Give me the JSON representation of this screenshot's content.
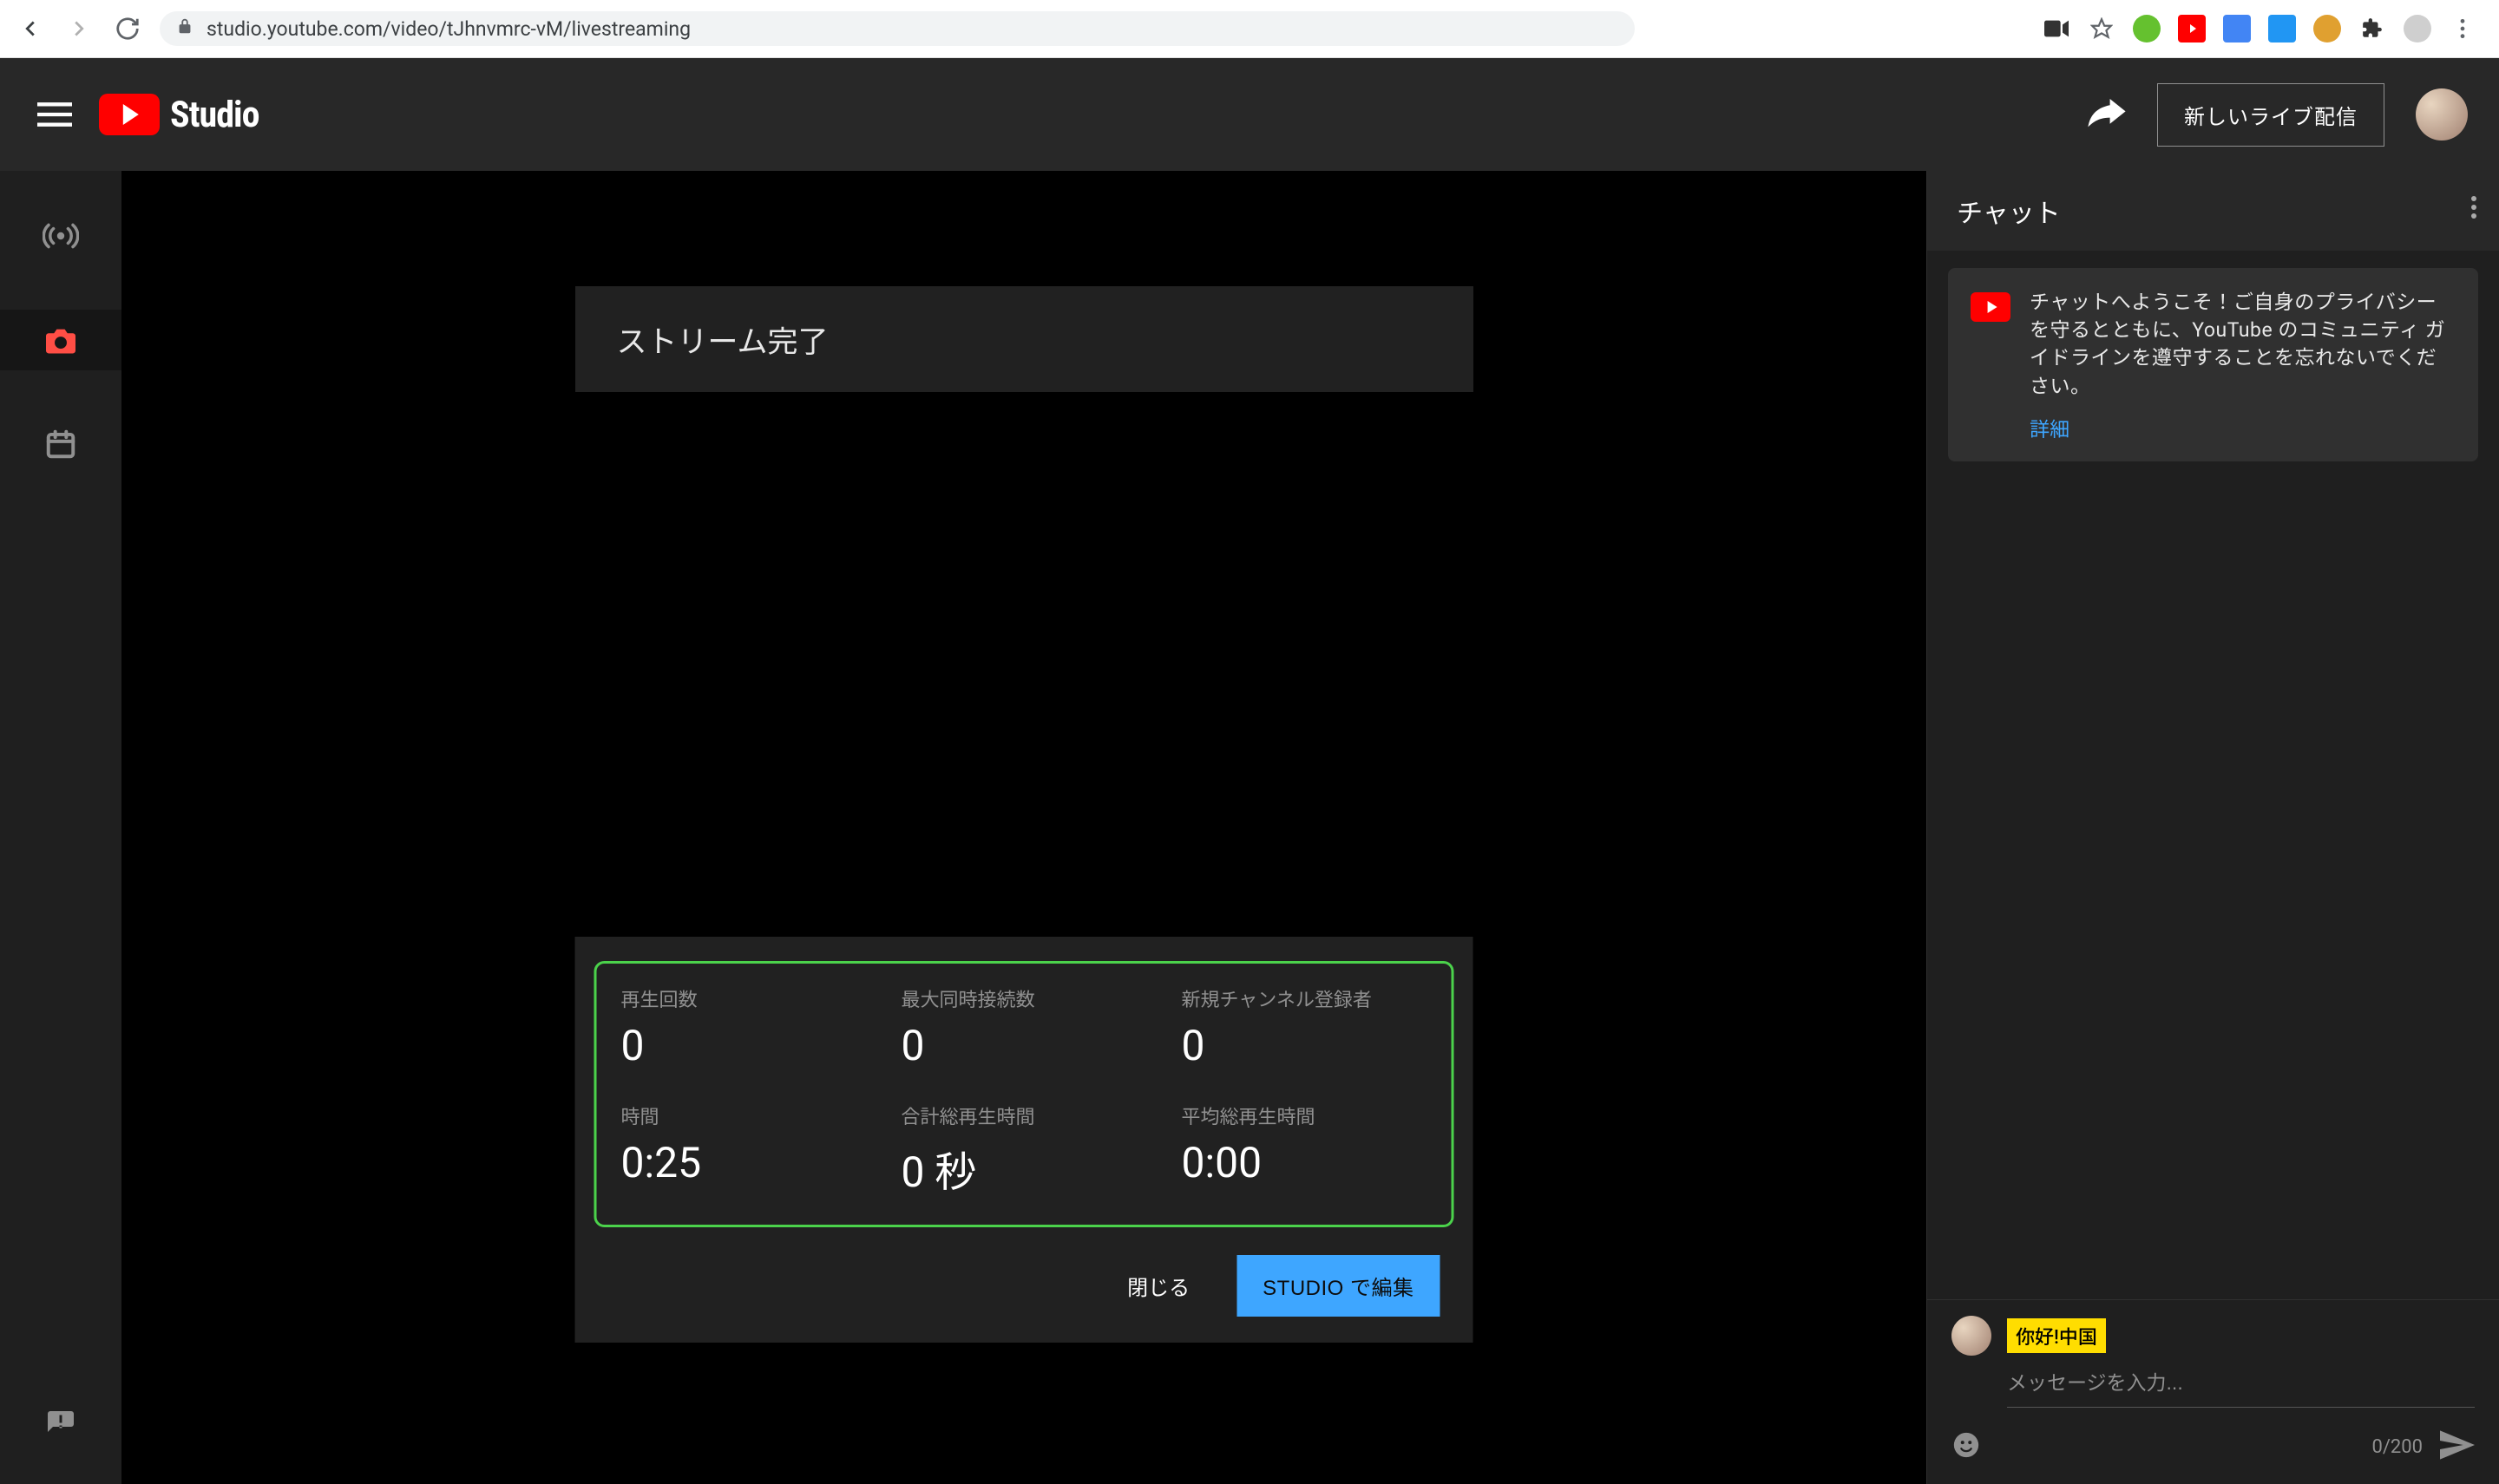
{
  "browser": {
    "url": "studio.youtube.com/video/tJhnvmrc-vM/livestreaming"
  },
  "header": {
    "logo_text": "Studio",
    "new_live_label": "新しいライブ配信"
  },
  "stream": {
    "complete_label": "ストリーム完了",
    "metrics": [
      {
        "label": "再生回数",
        "value": "0"
      },
      {
        "label": "最大同時接続数",
        "value": "0"
      },
      {
        "label": "新規チャンネル登録者",
        "value": "0"
      },
      {
        "label": "時間",
        "value": "0:25"
      },
      {
        "label": "合計総再生時間",
        "value": "0 秒"
      },
      {
        "label": "平均総再生時間",
        "value": "0:00"
      }
    ],
    "close_label": "閉じる",
    "edit_label": "STUDIO で編集"
  },
  "chat": {
    "title": "チャット",
    "notice_text": "チャットへようこそ！ご自身のプライバシーを守るとともに、YouTube のコミュニティ ガイドラインを遵守することを忘れないでください。",
    "notice_link": "詳細",
    "author_badge": "你好!中国",
    "input_placeholder": "メッセージを入力...",
    "char_count": "0/200"
  }
}
